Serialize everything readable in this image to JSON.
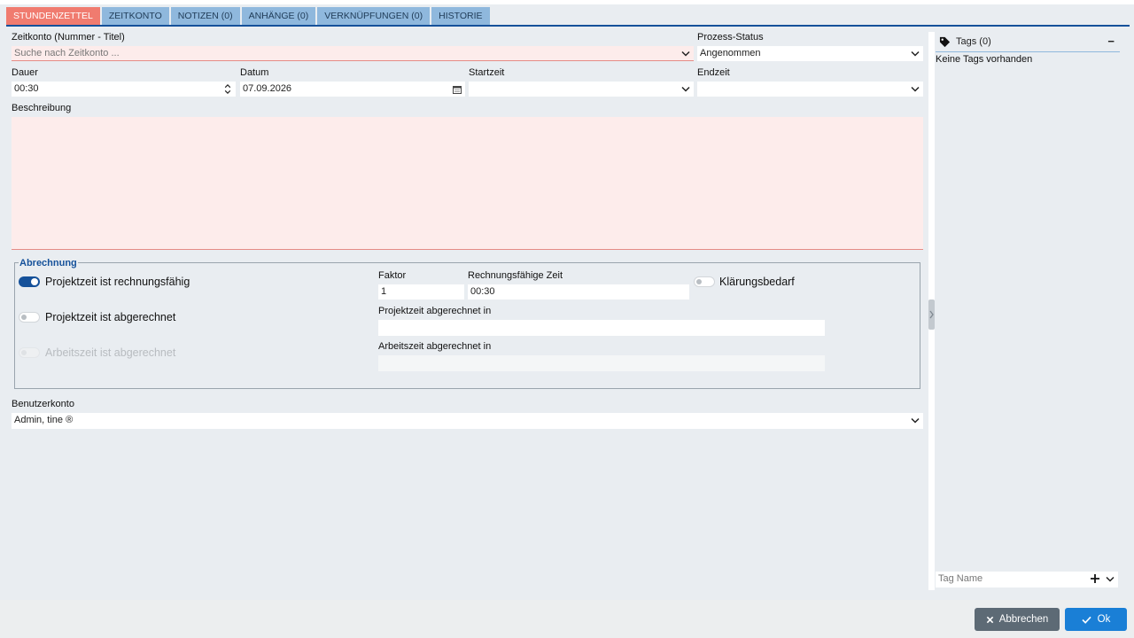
{
  "tabs": [
    {
      "label": "Stundenzettel"
    },
    {
      "label": "Zeitkonto"
    },
    {
      "label": "Notizen (0)"
    },
    {
      "label": "Anhänge (0)"
    },
    {
      "label": "Verknüpfungen (0)"
    },
    {
      "label": "Historie"
    }
  ],
  "form": {
    "account_label": "Zeitkonto (Nummer - Titel)",
    "account_placeholder": "Suche nach Zeitkonto ...",
    "status_label": "Prozess-Status",
    "status_value": "Angenommen",
    "duration_label": "Dauer",
    "duration_value": "00:30",
    "date_label": "Datum",
    "date_value": "07.09.2026",
    "start_label": "Startzeit",
    "start_value": "",
    "end_label": "Endzeit",
    "end_value": "",
    "description_label": "Beschreibung",
    "description_value": ""
  },
  "billing": {
    "legend": "Abrechnung",
    "billable_label": "Projektzeit ist rechnungsfähig",
    "billable_on": true,
    "billed_label": "Projektzeit ist abgerechnet",
    "billed_on": false,
    "worktime_billed_label": "Arbeitszeit ist abgerechnet",
    "worktime_billed_on": false,
    "factor_label": "Faktor",
    "factor_value": "1",
    "billable_time_label": "Rechnungsfähige Zeit",
    "billable_time_value": "00:30",
    "clarification_label": "Klärungsbedarf",
    "clarification_on": false,
    "project_billed_in_label": "Projektzeit abgerechnet in",
    "project_billed_in_value": "",
    "work_billed_in_label": "Arbeitszeit abgerechnet in",
    "work_billed_in_value": ""
  },
  "user_account": {
    "label": "Benutzerkonto",
    "value": "Admin, tine ®"
  },
  "tags": {
    "title": "Tags (0)",
    "collapse": "−",
    "empty_text": "Keine Tags vorhanden",
    "input_placeholder": "Tag Name"
  },
  "footer": {
    "cancel_label": "Abbrechen",
    "ok_label": "Ok"
  },
  "colors": {
    "accent": "#15519a",
    "active_tab": "#f07b6f",
    "tab": "#8fb8dd",
    "invalid_bg": "#fdeceb",
    "cancel_btn": "#5d6a75",
    "ok_btn": "#1a7fd6"
  }
}
